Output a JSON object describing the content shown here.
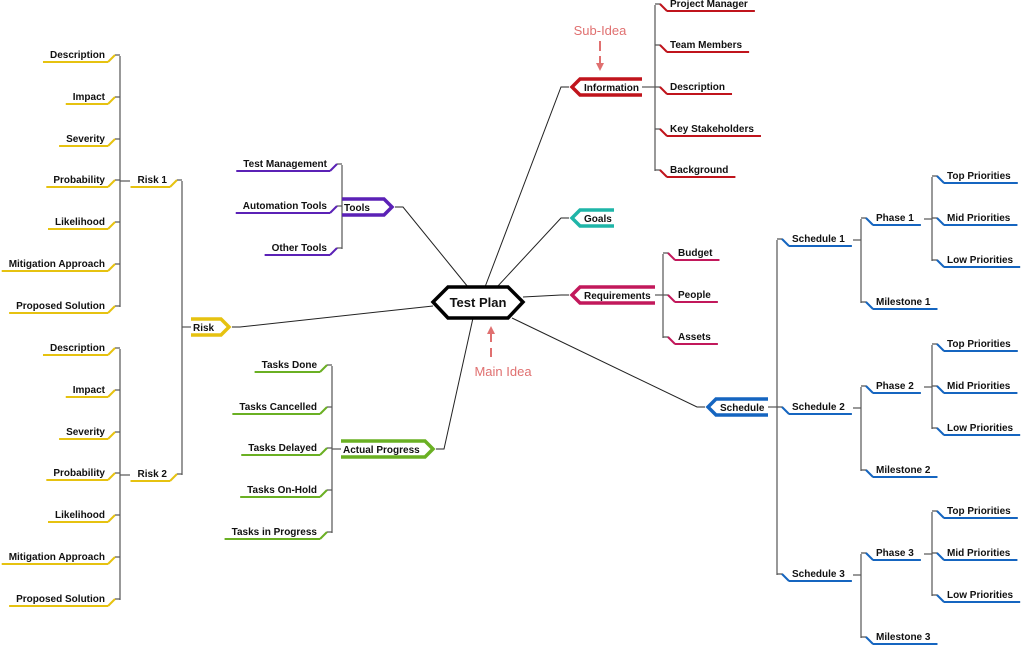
{
  "root": {
    "label": "Test Plan"
  },
  "annotations": {
    "main_idea": {
      "label": "Main Idea",
      "color": "#e07070"
    },
    "sub_idea": {
      "label": "Sub-Idea",
      "color": "#e07070"
    }
  },
  "branches": [
    {
      "id": "information",
      "label": "Information",
      "color": "#c0141c",
      "side": "right",
      "children": [
        {
          "label": "Project Manager"
        },
        {
          "label": "Team Members"
        },
        {
          "label": "Description"
        },
        {
          "label": "Key Stakeholders"
        },
        {
          "label": "Background"
        }
      ]
    },
    {
      "id": "goals",
      "label": "Goals",
      "color": "#1fb5a8",
      "side": "right",
      "children": []
    },
    {
      "id": "requirements",
      "label": "Requirements",
      "color": "#c2185b",
      "side": "right",
      "children": [
        {
          "label": "Budget"
        },
        {
          "label": "People"
        },
        {
          "label": "Assets"
        }
      ]
    },
    {
      "id": "schedule",
      "label": "Schedule",
      "color": "#1565c0",
      "side": "right",
      "children": [
        {
          "label": "Schedule 1",
          "children": [
            {
              "label": "Phase 1",
              "children": [
                {
                  "label": "Top Priorities"
                },
                {
                  "label": "Mid Priorities"
                },
                {
                  "label": "Low Priorities"
                }
              ]
            },
            {
              "label": "Milestone 1"
            }
          ]
        },
        {
          "label": "Schedule 2",
          "children": [
            {
              "label": "Phase 2",
              "children": [
                {
                  "label": "Top Priorities"
                },
                {
                  "label": "Mid Priorities"
                },
                {
                  "label": "Low Priorities"
                }
              ]
            },
            {
              "label": "Milestone 2"
            }
          ]
        },
        {
          "label": "Schedule 3",
          "children": [
            {
              "label": "Phase 3",
              "children": [
                {
                  "label": "Top Priorities"
                },
                {
                  "label": "Mid Priorities"
                },
                {
                  "label": "Low Priorities"
                }
              ]
            },
            {
              "label": "Milestone 3"
            }
          ]
        }
      ]
    },
    {
      "id": "tools",
      "label": "Tools",
      "color": "#5b21b6",
      "side": "left",
      "children": [
        {
          "label": "Test Management"
        },
        {
          "label": "Automation Tools"
        },
        {
          "label": "Other Tools"
        }
      ]
    },
    {
      "id": "risk",
      "label": "Risk",
      "color": "#e6c210",
      "side": "left",
      "children": [
        {
          "label": "Risk 1",
          "children": [
            {
              "label": "Description"
            },
            {
              "label": "Impact"
            },
            {
              "label": "Severity"
            },
            {
              "label": "Probability"
            },
            {
              "label": "Likelihood"
            },
            {
              "label": "Mitigation Approach"
            },
            {
              "label": "Proposed Solution"
            }
          ]
        },
        {
          "label": "Risk 2",
          "children": [
            {
              "label": "Description"
            },
            {
              "label": "Impact"
            },
            {
              "label": "Severity"
            },
            {
              "label": "Probability"
            },
            {
              "label": "Likelihood"
            },
            {
              "label": "Mitigation Approach"
            },
            {
              "label": "Proposed Solution"
            }
          ]
        }
      ]
    },
    {
      "id": "actual-progress",
      "label": "Actual Progress",
      "color": "#6ab023",
      "side": "left",
      "children": [
        {
          "label": "Tasks Done"
        },
        {
          "label": "Tasks Cancelled"
        },
        {
          "label": "Tasks Delayed"
        },
        {
          "label": "Tasks On-Hold"
        },
        {
          "label": "Tasks in Progress"
        }
      ]
    }
  ]
}
